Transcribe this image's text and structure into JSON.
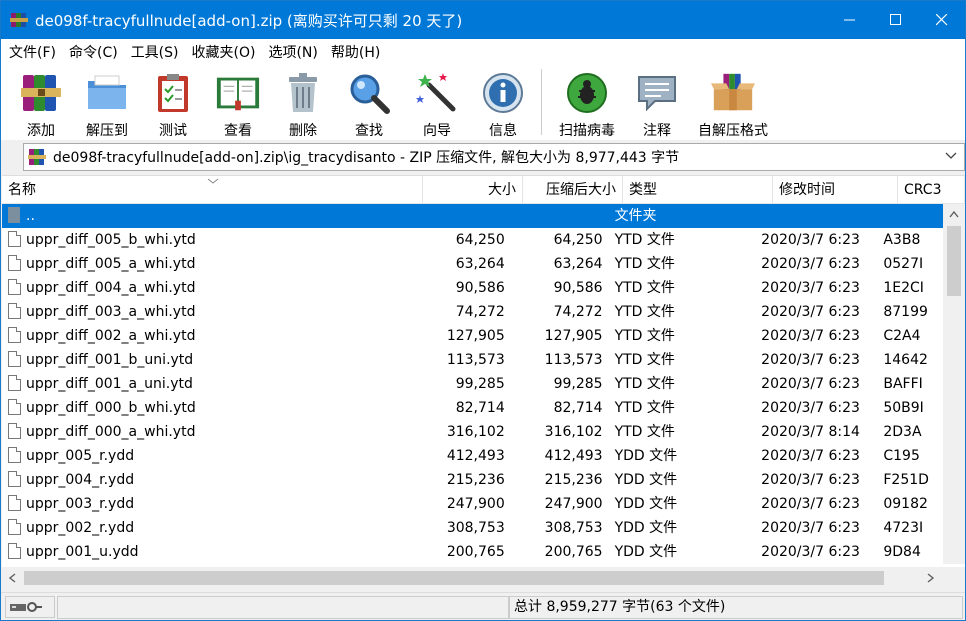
{
  "window": {
    "title": "de098f-tracyfullnude[add-on].zip (离购买许可只剩 20 天了)",
    "controls": {
      "minimize": "—",
      "maximize": "☐",
      "close": "✕"
    }
  },
  "menu": [
    "文件(F)",
    "命令(C)",
    "工具(S)",
    "收藏夹(O)",
    "选项(N)",
    "帮助(H)"
  ],
  "toolbar": [
    {
      "label": "添加",
      "icon": "books-add-icon"
    },
    {
      "label": "解压到",
      "icon": "folder-extract-icon"
    },
    {
      "label": "测试",
      "icon": "clipboard-test-icon"
    },
    {
      "label": "查看",
      "icon": "book-view-icon"
    },
    {
      "label": "删除",
      "icon": "trash-icon"
    },
    {
      "label": "查找",
      "icon": "magnifier-icon"
    },
    {
      "label": "向导",
      "icon": "wizard-wand-icon"
    },
    {
      "label": "信息",
      "icon": "info-icon"
    },
    {
      "label": "扫描病毒",
      "icon": "virus-scan-icon"
    },
    {
      "label": "注释",
      "icon": "comment-icon"
    },
    {
      "label": "自解压格式",
      "icon": "sfx-box-icon"
    }
  ],
  "address": {
    "path": "de098f-tracyfullnude[add-on].zip\\ig_tracydisanto - ZIP 压缩文件, 解包大小为 8,977,443 字节"
  },
  "columns": [
    "名称",
    "大小",
    "压缩后大小",
    "类型",
    "修改时间",
    "CRC3"
  ],
  "parent_row": {
    "name": "..",
    "type": "文件夹"
  },
  "files": [
    {
      "name": "uppr_diff_005_b_whi.ytd",
      "size": "64,250",
      "packed": "64,250",
      "type": "YTD 文件",
      "modified": "2020/3/7 6:23",
      "crc": "A3B8"
    },
    {
      "name": "uppr_diff_005_a_whi.ytd",
      "size": "63,264",
      "packed": "63,264",
      "type": "YTD 文件",
      "modified": "2020/3/7 6:23",
      "crc": "0527I"
    },
    {
      "name": "uppr_diff_004_a_whi.ytd",
      "size": "90,586",
      "packed": "90,586",
      "type": "YTD 文件",
      "modified": "2020/3/7 6:23",
      "crc": "1E2CI"
    },
    {
      "name": "uppr_diff_003_a_whi.ytd",
      "size": "74,272",
      "packed": "74,272",
      "type": "YTD 文件",
      "modified": "2020/3/7 6:23",
      "crc": "87199"
    },
    {
      "name": "uppr_diff_002_a_whi.ytd",
      "size": "127,905",
      "packed": "127,905",
      "type": "YTD 文件",
      "modified": "2020/3/7 6:23",
      "crc": "C2A4"
    },
    {
      "name": "uppr_diff_001_b_uni.ytd",
      "size": "113,573",
      "packed": "113,573",
      "type": "YTD 文件",
      "modified": "2020/3/7 6:23",
      "crc": "14642"
    },
    {
      "name": "uppr_diff_001_a_uni.ytd",
      "size": "99,285",
      "packed": "99,285",
      "type": "YTD 文件",
      "modified": "2020/3/7 6:23",
      "crc": "BAFFI"
    },
    {
      "name": "uppr_diff_000_b_whi.ytd",
      "size": "82,714",
      "packed": "82,714",
      "type": "YTD 文件",
      "modified": "2020/3/7 6:23",
      "crc": "50B9I"
    },
    {
      "name": "uppr_diff_000_a_whi.ytd",
      "size": "316,102",
      "packed": "316,102",
      "type": "YTD 文件",
      "modified": "2020/3/7 8:14",
      "crc": "2D3A"
    },
    {
      "name": "uppr_005_r.ydd",
      "size": "412,493",
      "packed": "412,493",
      "type": "YDD 文件",
      "modified": "2020/3/7 6:23",
      "crc": "C195"
    },
    {
      "name": "uppr_004_r.ydd",
      "size": "215,236",
      "packed": "215,236",
      "type": "YDD 文件",
      "modified": "2020/3/7 6:23",
      "crc": "F251D"
    },
    {
      "name": "uppr_003_r.ydd",
      "size": "247,900",
      "packed": "247,900",
      "type": "YDD 文件",
      "modified": "2020/3/7 6:23",
      "crc": "09182"
    },
    {
      "name": "uppr_002_r.ydd",
      "size": "308,753",
      "packed": "308,753",
      "type": "YDD 文件",
      "modified": "2020/3/7 6:23",
      "crc": "4723I"
    },
    {
      "name": "uppr_001_u.ydd",
      "size": "200,765",
      "packed": "200,765",
      "type": "YDD 文件",
      "modified": "2020/3/7 6:23",
      "crc": "9D84"
    }
  ],
  "status": {
    "total": "总计 8,959,277 字节(63 个文件)"
  },
  "colors": {
    "titlebar": "#0078d7",
    "selection": "#0078d7"
  }
}
